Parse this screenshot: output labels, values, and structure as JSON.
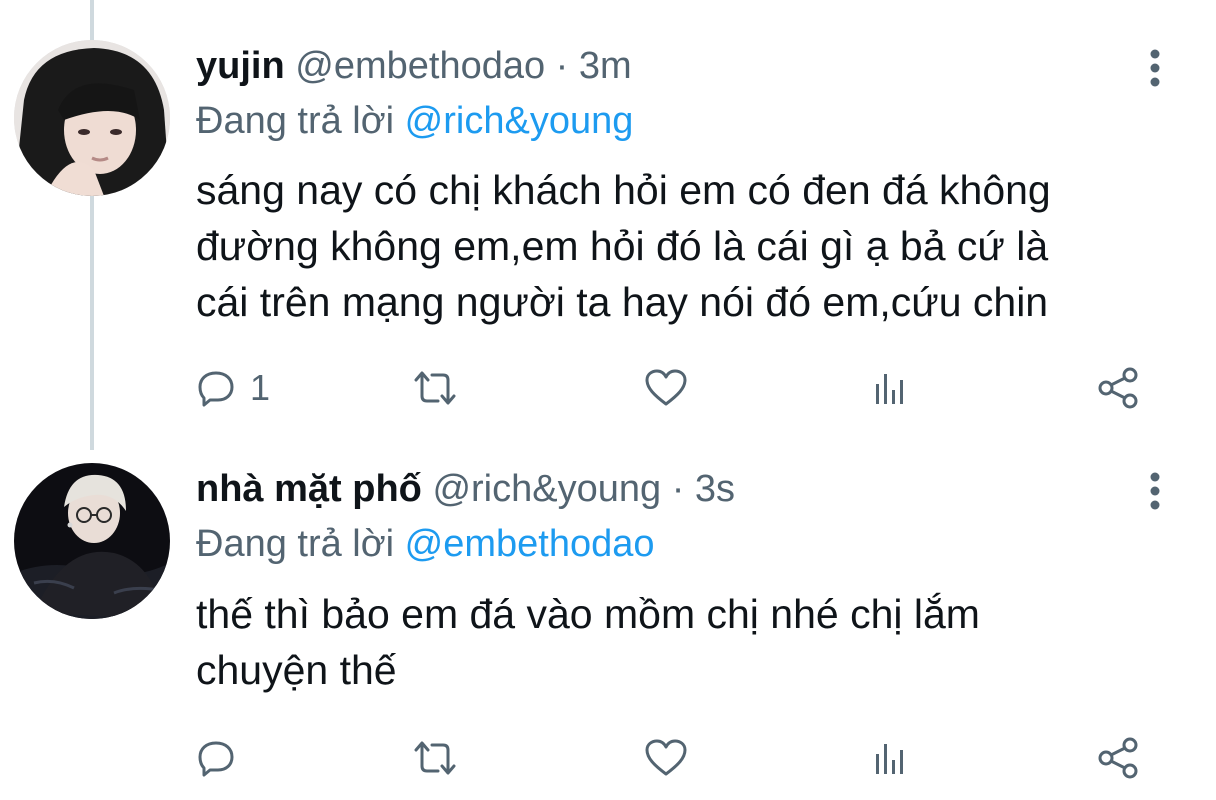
{
  "tweets": [
    {
      "display_name": "yujin",
      "handle": "@embethodao",
      "separator": "·",
      "time": "3m",
      "replying_label": "Đang trả lời",
      "replying_to": "@rich&young",
      "body_lines": [
        "sáng nay có chị khách hỏi em có đen đá không",
        "đường không em,em hỏi đó là cái gì ạ bả cứ là",
        "cái trên mạng người ta hay nói đó em,cứu chin"
      ],
      "reply_count": "1",
      "avatar_icon": "avatar-photo-dark-hair"
    },
    {
      "display_name": "nhà mặt phố",
      "handle": "@rich&young",
      "separator": "·",
      "time": "3s",
      "replying_label": "Đang trả lời",
      "replying_to": "@embethodao",
      "body_lines": [
        "thế thì bảo em đá vào mồm chị nhé chị lắm",
        "chuyện thế"
      ],
      "reply_count": "",
      "avatar_icon": "avatar-photo-light-hair"
    }
  ],
  "icons": {
    "reply": "reply-icon",
    "retweet": "retweet-icon",
    "like": "like-icon",
    "stats": "stats-icon",
    "share": "share-icon",
    "more": "more-icon"
  },
  "colors": {
    "text": "#0f1419",
    "secondary": "#536471",
    "mention": "#1d9bf0",
    "thread_line": "#cfd9de",
    "background": "#ffffff"
  }
}
